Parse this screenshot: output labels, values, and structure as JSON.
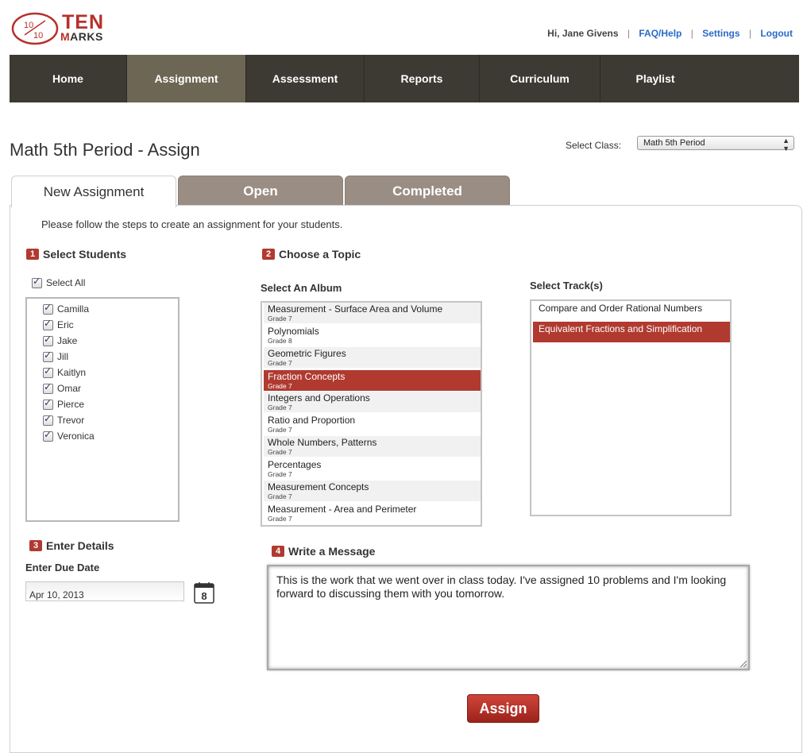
{
  "brand": {
    "logo_top": "TEN",
    "logo_bottom_a": "M",
    "logo_bottom_b": "ARKS",
    "logo_numerator": "10",
    "logo_denominator": "10"
  },
  "topbar": {
    "greeting": "Hi, Jane Givens",
    "faq": "FAQ/Help",
    "settings": "Settings",
    "logout": "Logout"
  },
  "nav": [
    "Home",
    "Assignment",
    "Assessment",
    "Reports",
    "Curriculum",
    "Playlist"
  ],
  "page": {
    "title": "Math 5th Period - Assign",
    "select_class_label": "Select Class:",
    "select_class_value": "Math 5th Period"
  },
  "tabs": [
    "New Assignment",
    "Open",
    "Completed"
  ],
  "intro": "Please follow the steps to create an assignment for your students.",
  "step1": {
    "num": "1",
    "title": "Select Students",
    "select_all": "Select All",
    "students": [
      "Camilla",
      "Eric",
      "Jake",
      "Jill",
      "Kaitlyn",
      "Omar",
      "Pierce",
      "Trevor",
      "Veronica"
    ]
  },
  "step2": {
    "num": "2",
    "title": "Choose a Topic",
    "album_label": "Select An Album",
    "track_label": "Select Track(s)",
    "albums": [
      {
        "name": "Measurement - Surface Area and Volume",
        "grade": "Grade 7"
      },
      {
        "name": "Polynomials",
        "grade": "Grade 8"
      },
      {
        "name": "Geometric Figures",
        "grade": "Grade 7"
      },
      {
        "name": "Fraction Concepts",
        "grade": "Grade 7"
      },
      {
        "name": "Integers and Operations",
        "grade": "Grade 7"
      },
      {
        "name": "Ratio and Proportion",
        "grade": "Grade 7"
      },
      {
        "name": "Whole Numbers, Patterns",
        "grade": "Grade 7"
      },
      {
        "name": "Percentages",
        "grade": "Grade 7"
      },
      {
        "name": "Measurement Concepts",
        "grade": "Grade 7"
      },
      {
        "name": "Measurement - Area and Perimeter",
        "grade": "Grade 7"
      }
    ],
    "tracks": [
      "Compare and Order Rational Numbers",
      "Equivalent Fractions and Simplification"
    ]
  },
  "step3": {
    "num": "3",
    "title": "Enter Details",
    "due_label": "Enter Due Date",
    "due_value": "Apr 10, 2013",
    "calendar_day": "8"
  },
  "step4": {
    "num": "4",
    "title": "Write a Message",
    "message": "This is the work that we went over in class today. I've assigned 10 problems and I'm looking forward to discussing them with you tomorrow."
  },
  "assign_button": "Assign",
  "colors": {
    "accent": "#b03a30",
    "nav_bg": "#3d3a33",
    "nav_active": "#6e6654",
    "tab_inactive": "#9a8e84",
    "link": "#2a6bc9"
  }
}
